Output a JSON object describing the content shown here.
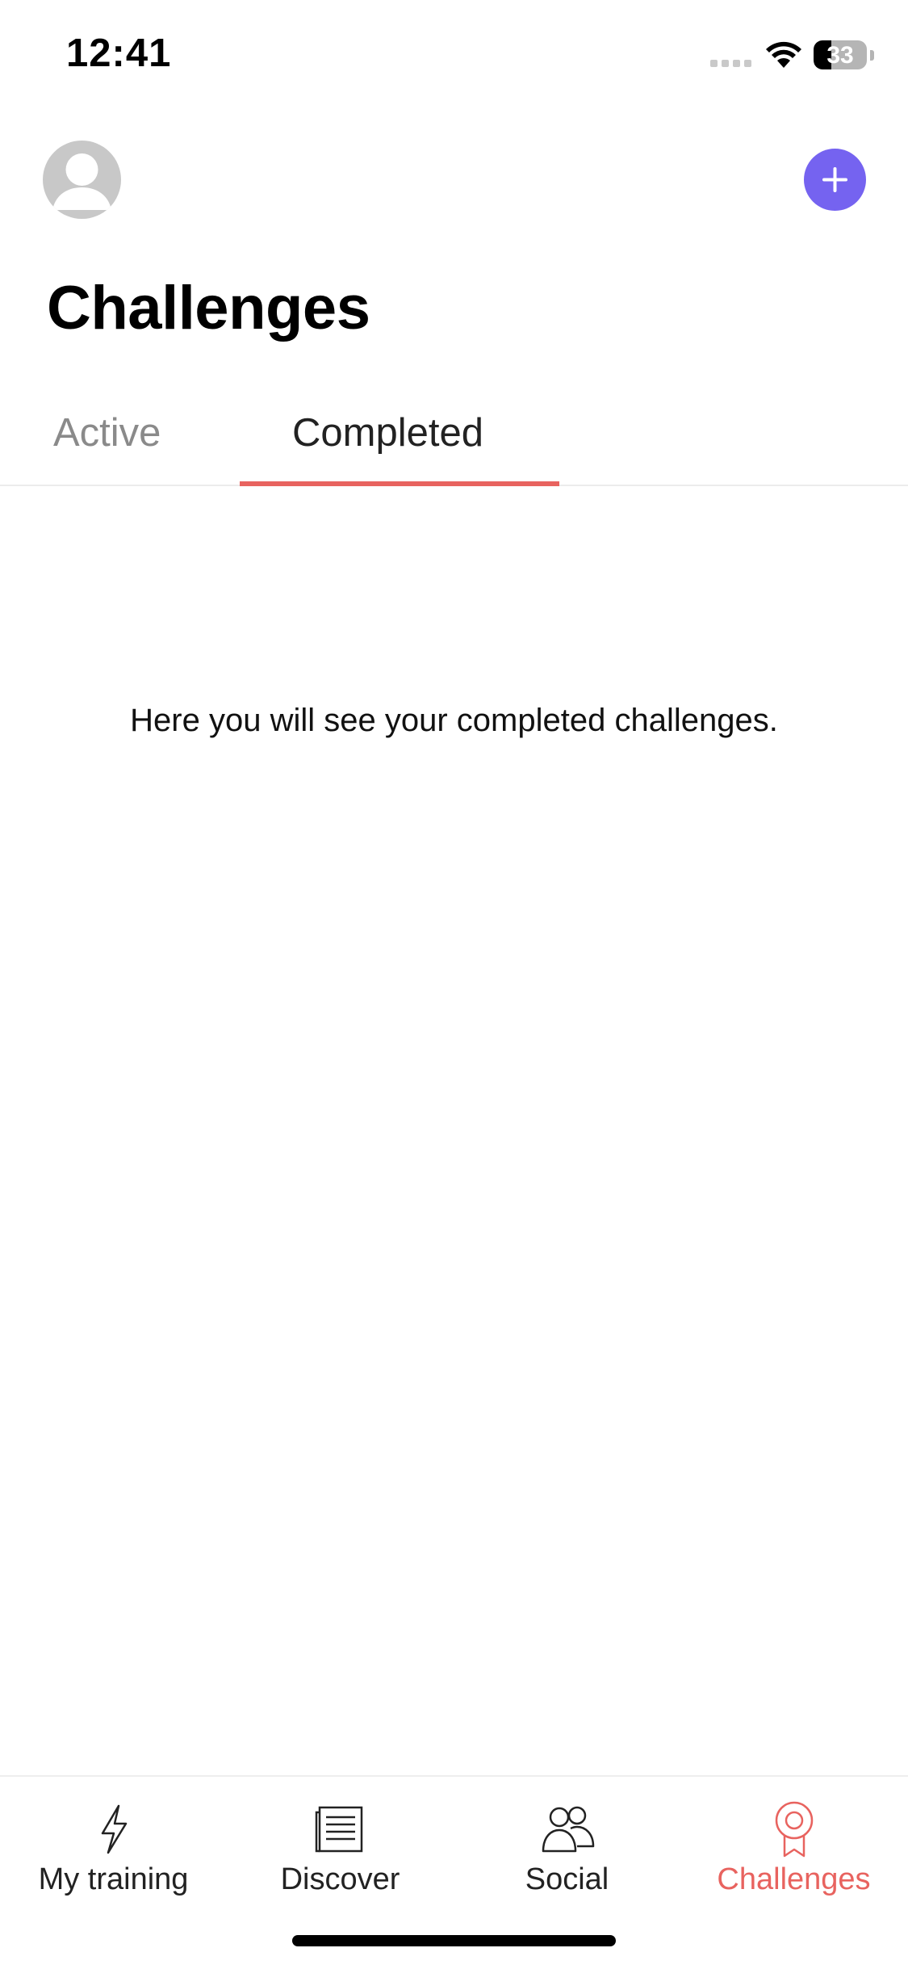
{
  "status_bar": {
    "time": "12:41",
    "battery_level": "33",
    "battery_fraction": 0.33,
    "icons": [
      "signal-icon",
      "wifi-icon",
      "battery-icon"
    ]
  },
  "header": {
    "title": "Challenges",
    "avatar_icon": "person-icon",
    "add_icon": "plus-icon"
  },
  "tabs": [
    {
      "label": "Active",
      "selected": false
    },
    {
      "label": "Completed",
      "selected": true
    }
  ],
  "empty_state": {
    "message": "Here you will see your completed challenges."
  },
  "bottom_nav": {
    "items": [
      {
        "label": "My training",
        "icon": "lightning-icon",
        "selected": false
      },
      {
        "label": "Discover",
        "icon": "newspaper-icon",
        "selected": false
      },
      {
        "label": "Social",
        "icon": "people-icon",
        "selected": false
      },
      {
        "label": "Challenges",
        "icon": "medal-icon",
        "selected": true
      }
    ]
  },
  "colors": {
    "accent": "#e8635f",
    "add_button": "#7563f0",
    "inactive_tab_text": "#8a8a8a",
    "avatar_bg": "#c8c8c8"
  }
}
